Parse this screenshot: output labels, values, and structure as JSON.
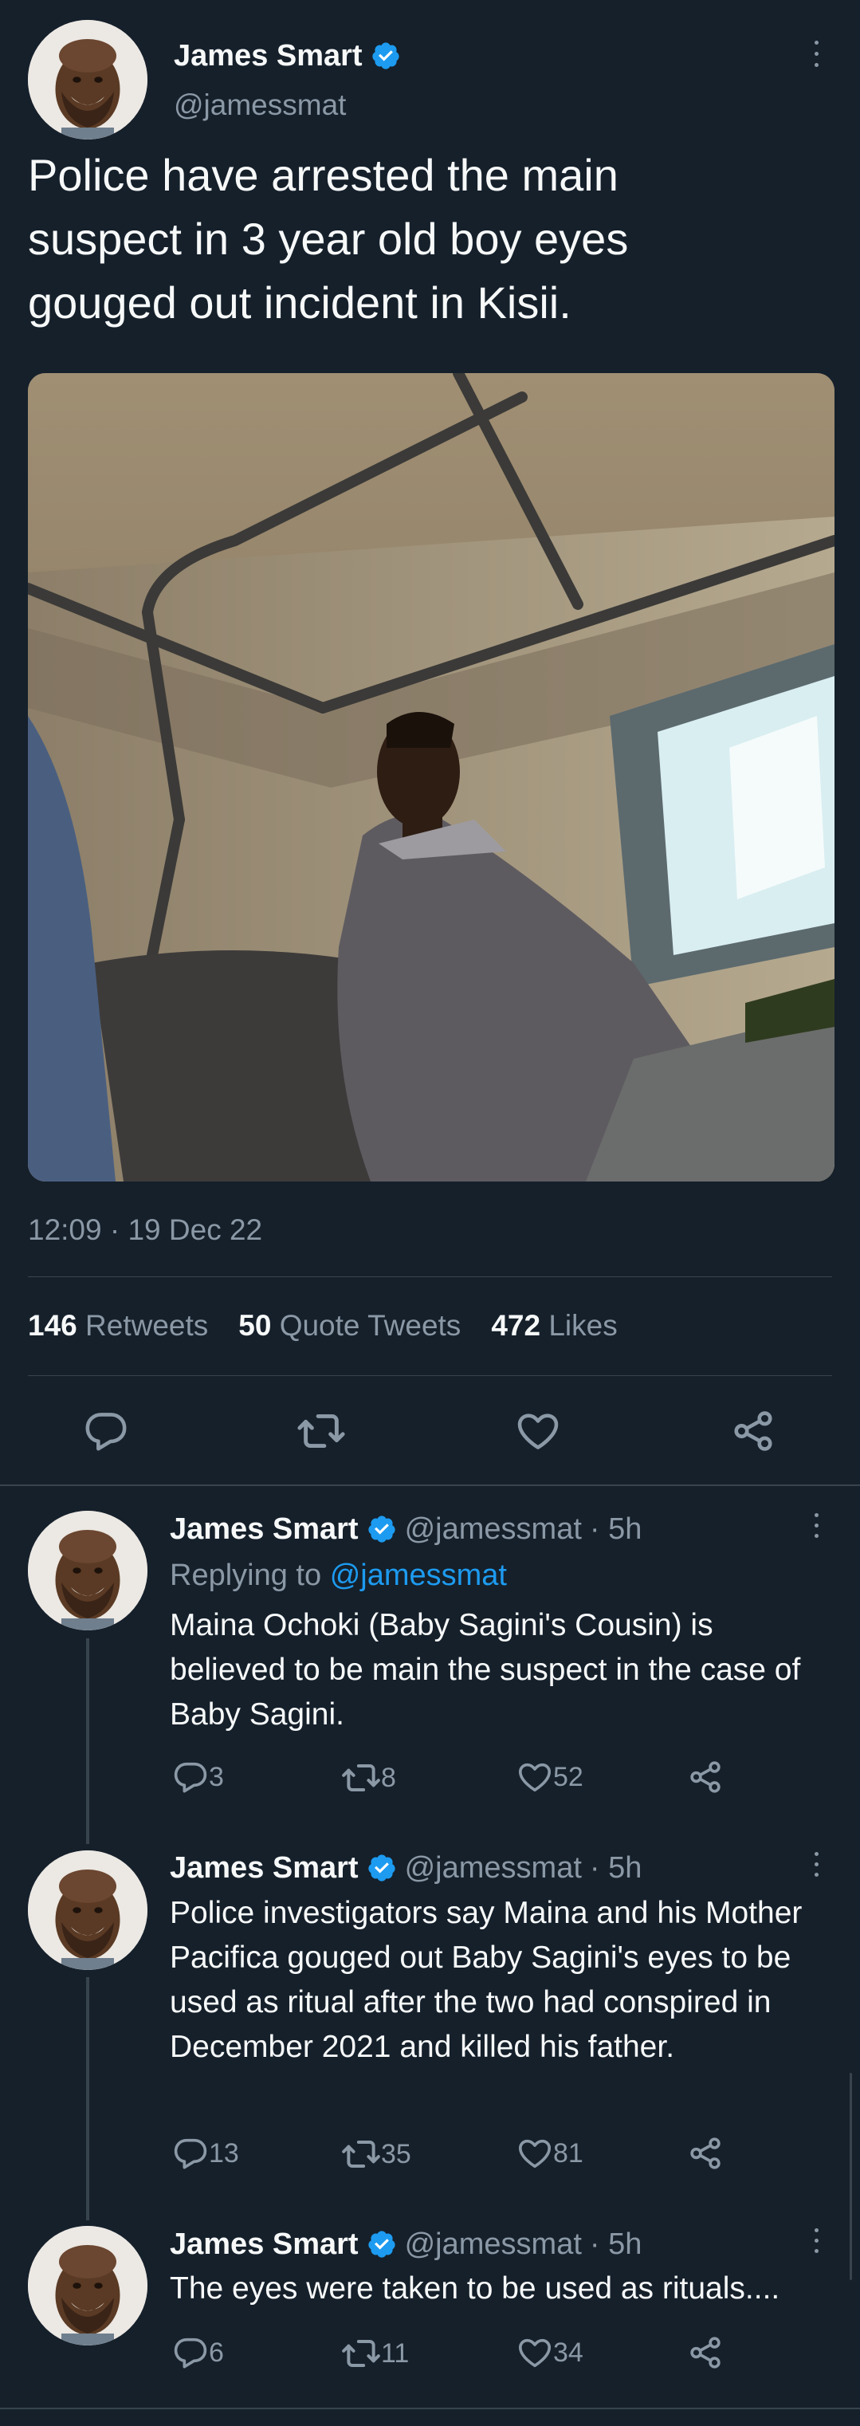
{
  "main_tweet": {
    "author_name": "James Smart",
    "author_handle": "@jamessmat",
    "text": "Police have arrested the main suspect in 3 year old boy eyes gouged out incident in Kisii.",
    "timestamp": "12:09 · 19 Dec 22",
    "stats": {
      "retweets_count": "146",
      "retweets_label": "Retweets",
      "quotes_count": "50",
      "quotes_label": "Quote Tweets",
      "likes_count": "472",
      "likes_label": "Likes"
    }
  },
  "replies": [
    {
      "author_name": "James Smart",
      "author_handle": "@jamessmat",
      "time": "· 5h",
      "replying_prefix": "Replying to",
      "replying_to": "@jamessmat",
      "text": "Maina Ochoki (Baby Sagini's Cousin) is believed to be main the suspect in the case of Baby Sagini.",
      "replies": "3",
      "retweets": "8",
      "likes": "52"
    },
    {
      "author_name": "James Smart",
      "author_handle": "@jamessmat",
      "time": "· 5h",
      "text": "Police investigators say Maina and his Mother Pacifica  gouged out Baby Sagini's eyes to be used as ritual after the two had conspired in December 2021 and killed his father.",
      "replies": "13",
      "retweets": "35",
      "likes": "81"
    },
    {
      "author_name": "James Smart",
      "author_handle": "@jamessmat",
      "time": "· 5h",
      "text": "The eyes were taken to be used as rituals....",
      "replies": "6",
      "retweets": "11",
      "likes": "34"
    }
  ],
  "colors": {
    "background": "#15202b",
    "accent": "#1d9bf0",
    "muted": "#8b98a5",
    "divider": "#38444d"
  },
  "icons": [
    "verified-badge-icon",
    "more-options-icon",
    "reply-icon",
    "retweet-icon",
    "like-icon",
    "share-icon"
  ]
}
